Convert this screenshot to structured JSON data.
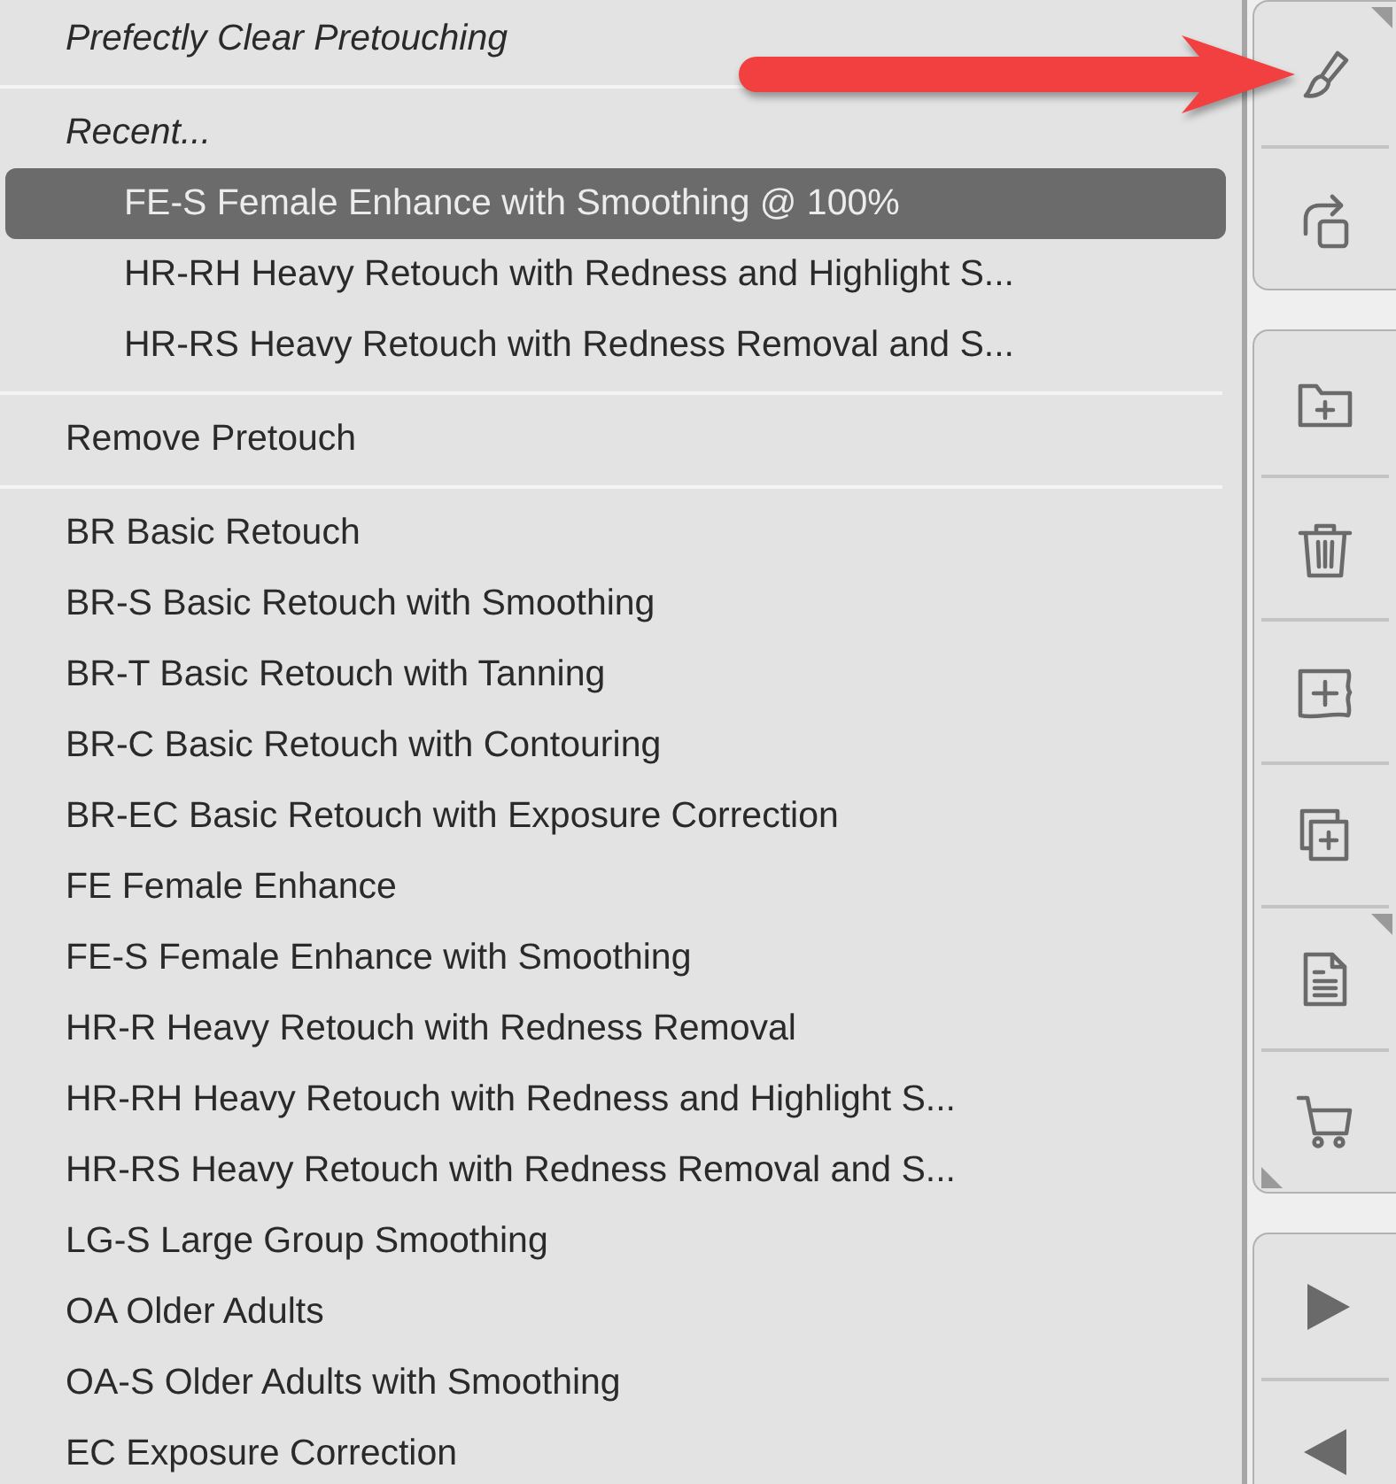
{
  "menu": {
    "title": "Prefectly Clear Pretouching",
    "recent": {
      "label": "Recent...",
      "items": [
        {
          "label": "FE-S Female Enhance with Smoothing @ 100%",
          "selected": true
        },
        {
          "label": "HR-RH Heavy Retouch with Redness and Highlight S...",
          "selected": false
        },
        {
          "label": "HR-RS Heavy Retouch with Redness Removal and S...",
          "selected": false
        }
      ]
    },
    "actions": [
      {
        "label": "Remove Pretouch"
      }
    ],
    "presets": [
      {
        "label": "BR Basic Retouch",
        "selected": false
      },
      {
        "label": "BR-S Basic Retouch with Smoothing",
        "selected": false
      },
      {
        "label": "BR-T Basic Retouch with Tanning",
        "selected": false
      },
      {
        "label": "BR-C Basic Retouch with Contouring",
        "selected": false
      },
      {
        "label": "BR-EC Basic Retouch with Exposure Correction",
        "selected": false
      },
      {
        "label": "FE Female Enhance",
        "selected": false
      },
      {
        "label": "FE-S Female Enhance with Smoothing",
        "selected": false
      },
      {
        "label": "HR-R Heavy Retouch with Redness Removal",
        "selected": false
      },
      {
        "label": "HR-RH Heavy Retouch with Redness and Highlight S...",
        "selected": false
      },
      {
        "label": "HR-RS Heavy Retouch with Redness Removal and S...",
        "selected": false
      },
      {
        "label": "LG-S Large Group Smoothing",
        "selected": false
      },
      {
        "label": "OA Older Adults",
        "selected": false
      },
      {
        "label": "OA-S Older Adults with Smoothing",
        "selected": false
      },
      {
        "label": "EC Exposure Correction",
        "selected": false
      }
    ]
  },
  "toolbar": {
    "groups": [
      {
        "buttons": [
          {
            "kind": "brush",
            "submenu_top": true,
            "submenu_bottom": false
          },
          {
            "kind": "rotate",
            "submenu_top": false,
            "submenu_bottom": false
          }
        ]
      },
      {
        "buttons": [
          {
            "kind": "new-folder",
            "submenu_top": false,
            "submenu_bottom": false
          },
          {
            "kind": "trash",
            "submenu_top": false,
            "submenu_bottom": false
          },
          {
            "kind": "add-frame",
            "submenu_top": false,
            "submenu_bottom": false
          },
          {
            "kind": "duplicate",
            "submenu_top": false,
            "submenu_bottom": false
          },
          {
            "kind": "document",
            "submenu_top": true,
            "submenu_bottom": false
          },
          {
            "kind": "cart",
            "submenu_top": false,
            "submenu_bottom": true
          }
        ]
      },
      {
        "buttons": [
          {
            "kind": "play",
            "submenu_top": false,
            "submenu_bottom": false
          },
          {
            "kind": "back",
            "submenu_top": false,
            "submenu_bottom": false
          }
        ]
      }
    ]
  }
}
